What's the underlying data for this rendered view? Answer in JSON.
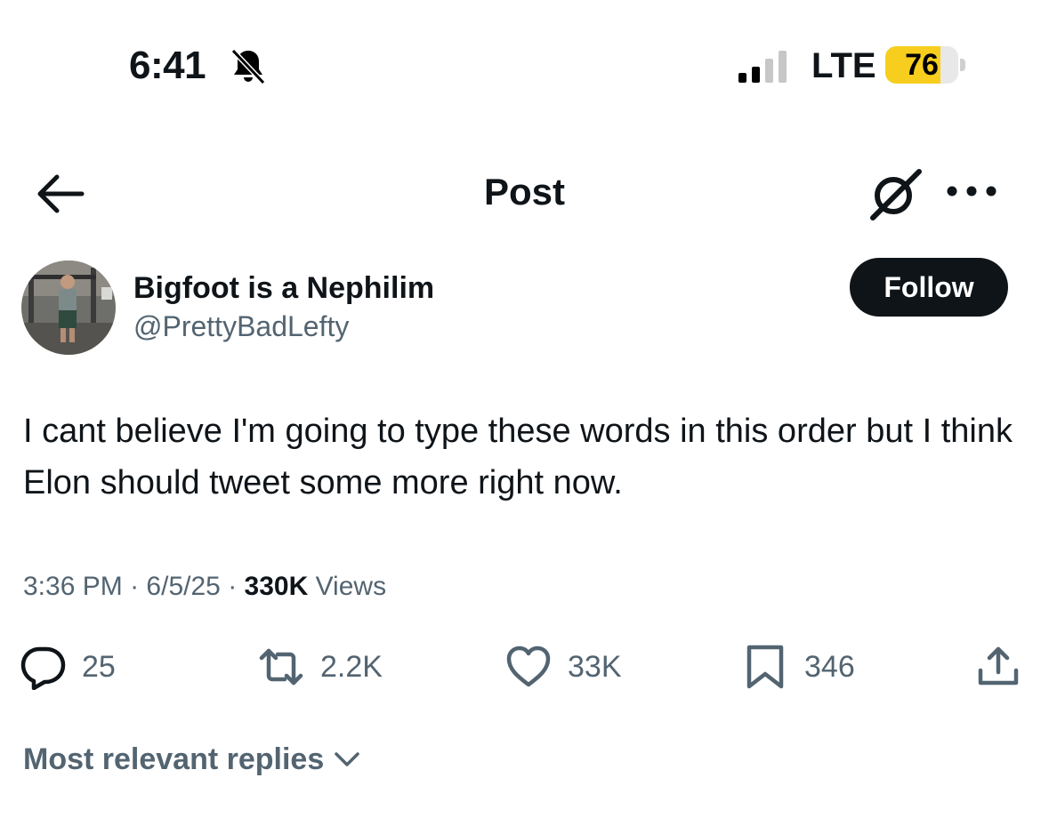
{
  "status_bar": {
    "time": "6:41",
    "network": "LTE",
    "battery": "76",
    "battery_level": 0.76,
    "silent_icon": "bell-slash-icon",
    "signal_icon": "cellular-signal-icon"
  },
  "header": {
    "title": "Post",
    "back_icon": "arrow-left-icon",
    "grok_icon": "grok-icon",
    "more_icon": "more-horizontal-icon"
  },
  "author": {
    "name": "Bigfoot is a Nephilim",
    "handle": "@PrettyBadLefty",
    "follow_label": "Follow"
  },
  "post": {
    "text": "I cant believe I'm going to type these words in this order but I think Elon should tweet some more right now.",
    "time": "3:36 PM",
    "date": "6/5/25",
    "views_count": "330K",
    "views_label": "Views",
    "separator": "·"
  },
  "actions": {
    "replies": "25",
    "reposts": "2.2K",
    "likes": "33K",
    "bookmarks": "346"
  },
  "replies_sort": {
    "label": "Most relevant replies",
    "icon": "chevron-down-icon"
  },
  "colors": {
    "text": "#0f1419",
    "secondary": "#536471",
    "follow_bg": "#0f1419",
    "battery_fill": "#f7ce1e"
  }
}
